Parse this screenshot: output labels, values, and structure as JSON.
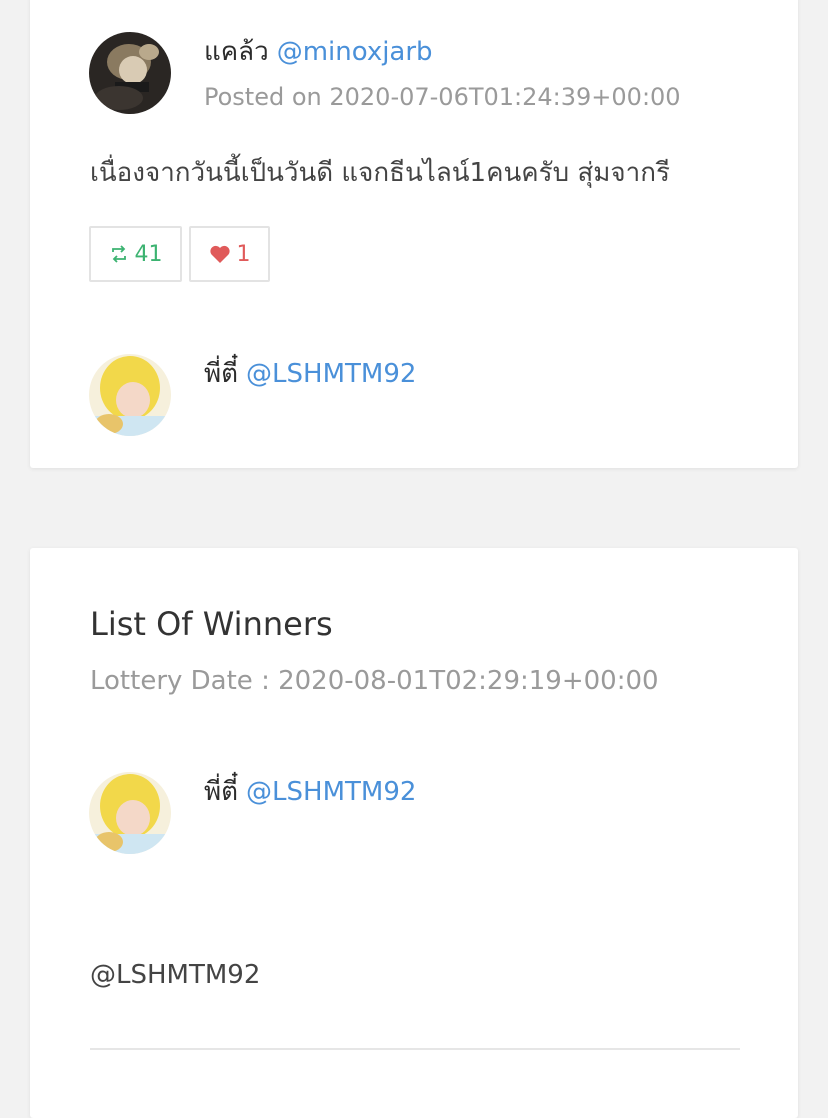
{
  "tweet": {
    "author_name": "แคล้ว",
    "author_handle": "@minoxjarb",
    "posted": "Posted on 2020-07-06T01:24:39+00:00",
    "text": "เนื่องจากวันนี้เป็นวันดี แจกธีนไลน์1คนครับ สุ่มจากรี",
    "retweets": "41",
    "likes": "1",
    "retweet_color": "#3cb371",
    "like_color": "#e05a5a"
  },
  "participant": {
    "name": "พี่ตี๋",
    "handle": "@LSHMTM92"
  },
  "winners": {
    "title": "List Of Winners",
    "lottery_date": "Lottery Date : 2020-08-01T02:29:19+00:00",
    "winner_name": "พี่ตี๋",
    "winner_handle": "@LSHMTM92",
    "winner_text": "@LSHMTM92"
  },
  "icons": {
    "retweet": "retweet-icon",
    "like": "heart-icon"
  },
  "colors": {
    "link": "#4a90d9",
    "background": "#f2f2f2",
    "card": "#ffffff"
  }
}
